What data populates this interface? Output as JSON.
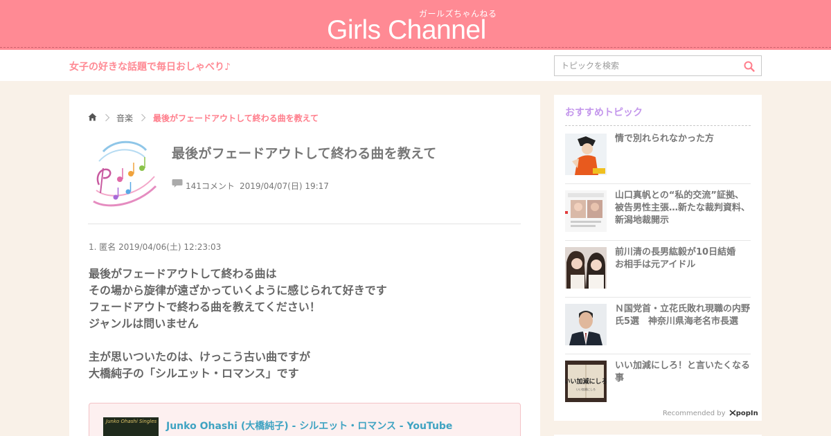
{
  "header": {
    "logo_kana": "ガールズちゃんねる",
    "logo_text": "Girls Channel",
    "tagline": "女子の好きな話題で毎日おしゃべり♪",
    "search_placeholder": "トピックを検索"
  },
  "breadcrumb": {
    "category": "音楽",
    "current": "最後がフェードアウトして終わる曲を教えて"
  },
  "topic": {
    "title": "最後がフェードアウトして終わる曲を教えて",
    "comment_count": "141コメント",
    "posted": "2019/04/07(日) 19:17"
  },
  "comment": {
    "header": "1. 匿名 2019/04/06(土) 12:23:03",
    "lines": [
      "最後がフェードアウトして終わる曲は",
      "その場から旋律が遠ざかっていくように感じられて好きです",
      "フェードアウトで終わる曲を教えてください！",
      "ジャンルは問いません",
      "",
      "主が思いついたのは、けっこう古い曲ですが",
      "大橋純子の「シルエット・ロマンス」です"
    ],
    "video_title": "Junko Ohashi (大橋純子) - シルエット・ロマンス - YouTube",
    "video_thumb_text": "Junko Ohashi Singles"
  },
  "sidebar": {
    "title": "おすすめトピック",
    "items": [
      {
        "text": "情で別れられなかった方"
      },
      {
        "text": "山口真帆との“私的交流”証拠、被告男性主張…新たな裁判資料、新潟地裁開示"
      },
      {
        "text": "前川清の長男紘毅が10日結婚　お相手は元アイドル"
      },
      {
        "text": "Ｎ国党首・立花氏敗れ現職の内野氏5選　神奈川県海老名市長選"
      },
      {
        "text": "いい加減にしろ！と言いたくなる事"
      }
    ],
    "thumb_texts": [
      "いい加減にしろ",
      "いい加減にしろ"
    ],
    "recommended_by": "Recommended by",
    "recommended_brand": "popIn"
  },
  "colors": {
    "brand_pink": "#ff8a94",
    "accent_purple": "#c497ec",
    "link_blue": "#3fa3c2",
    "page_bg": "#f9f1e8"
  }
}
